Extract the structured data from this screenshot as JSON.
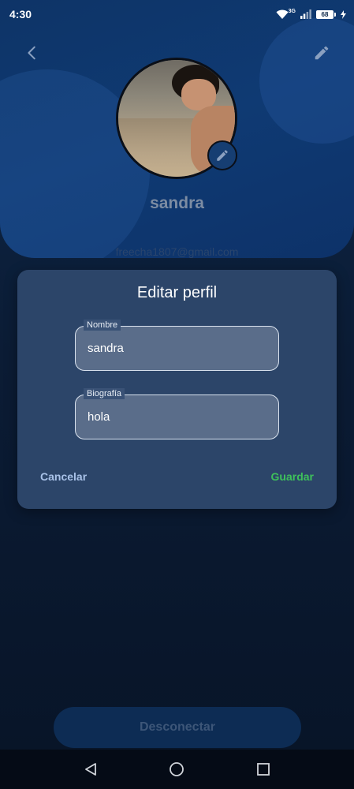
{
  "status_bar": {
    "time": "4:30",
    "network_type": "3G",
    "battery_level": "68",
    "icons": [
      "wifi-icon",
      "signal-icon",
      "battery-icon",
      "charging-icon"
    ]
  },
  "header": {
    "back_icon": "chevron-left-icon",
    "edit_icon": "pencil-icon",
    "avatar_edit_icon": "pencil-icon",
    "name": "sandra",
    "email": "freecha1807@gmail.com"
  },
  "dialog": {
    "title": "Editar perfil",
    "fields": [
      {
        "label": "Nombre",
        "value": "sandra"
      },
      {
        "label": "Biografía",
        "value": "hola"
      }
    ],
    "cancel_label": "Cancelar",
    "save_label": "Guardar"
  },
  "disconnect_label": "Desconectar",
  "nav": {
    "icons": [
      "back-triangle-icon",
      "home-circle-icon",
      "recents-square-icon"
    ]
  },
  "colors": {
    "header_bg": "#0f3a73",
    "dialog_bg": "#2c4569",
    "save_green": "#3ec15b",
    "cancel_blue": "#a9c2e8"
  }
}
